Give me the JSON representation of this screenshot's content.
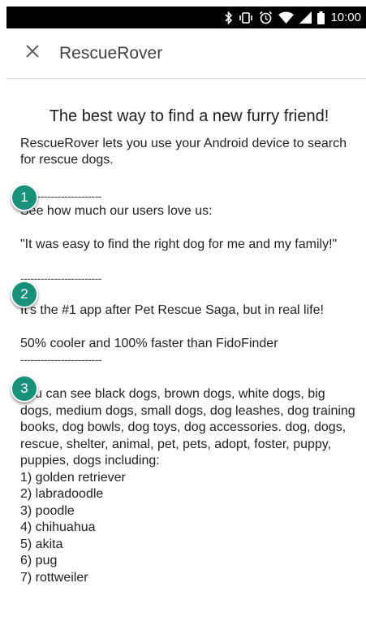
{
  "status_bar": {
    "time": "10:00",
    "icons": [
      "bluetooth-icon",
      "vibrate-icon",
      "alarm-icon",
      "wifi-icon",
      "signal-icon",
      "battery-icon"
    ]
  },
  "app_bar": {
    "close_icon": "close-icon",
    "title": "RescueRover"
  },
  "content": {
    "headline": "The best way to find a new furry friend!",
    "intro": "RescueRover lets you use your Android device to search for rescue dogs.",
    "divider": "------------------------",
    "section1_line1": "See how much our users love us:",
    "section1_quote": "\"It was easy to find the right dog for me and my family!\"",
    "section2_line1": "It's the #1 app after Pet Rescue Saga, but in real life!",
    "section2_line2": "50% cooler and 100% faster than FidoFinder",
    "section3_text": "You can see black dogs, brown dogs, white dogs, big dogs, medium dogs, small dogs, dog leashes, dog training books, dog bowls, dog toys, dog accessories. dog, dogs, rescue, shelter, animal, pet, pets, adopt, foster, puppy, puppies, dogs including:",
    "breeds": [
      "1) golden retriever",
      "2) labradoodle",
      "3) poodle",
      "4) chihuahua",
      "5) akita",
      "6) pug",
      "7) rottweiler"
    ]
  },
  "badges": [
    "1",
    "2",
    "3"
  ],
  "colors": {
    "badge": "#17917a",
    "status_bar": "#000000",
    "title_text": "#424242"
  }
}
